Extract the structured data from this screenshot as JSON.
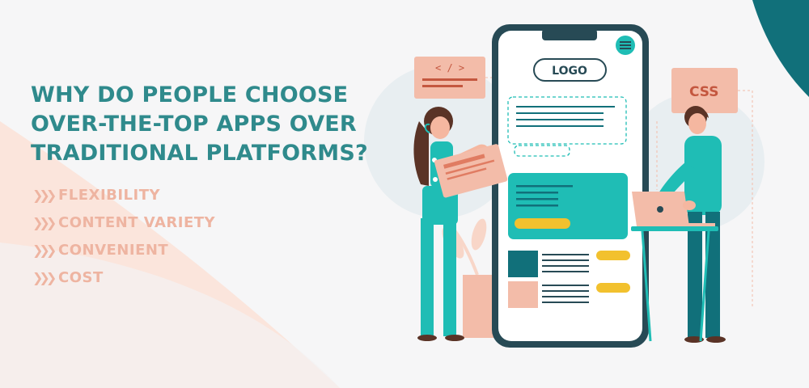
{
  "headline": {
    "line1": "WHY DO PEOPLE CHOOSE",
    "line2": "OVER-THE-TOP APPS OVER",
    "line3": "TRADITIONAL PLATFORMS?"
  },
  "features": [
    {
      "icon": "double-chevron-right-icon",
      "label": "FLEXIBILITY"
    },
    {
      "icon": "double-chevron-right-icon",
      "label": "CONTENT VARIETY"
    },
    {
      "icon": "double-chevron-right-icon",
      "label": "CONVENIENT"
    },
    {
      "icon": "double-chevron-right-icon",
      "label": "COST"
    }
  ],
  "illustration": {
    "phone_logo": "LOGO",
    "code_tag": "< / >",
    "css_tag": "CSS"
  },
  "colors": {
    "teal": "#1fbdb5",
    "dark_teal": "#2f8a8c",
    "deep_teal": "#11707a",
    "salmon": "#f3bca9",
    "yellow": "#f2c12e",
    "phone_frame": "#274a55"
  }
}
